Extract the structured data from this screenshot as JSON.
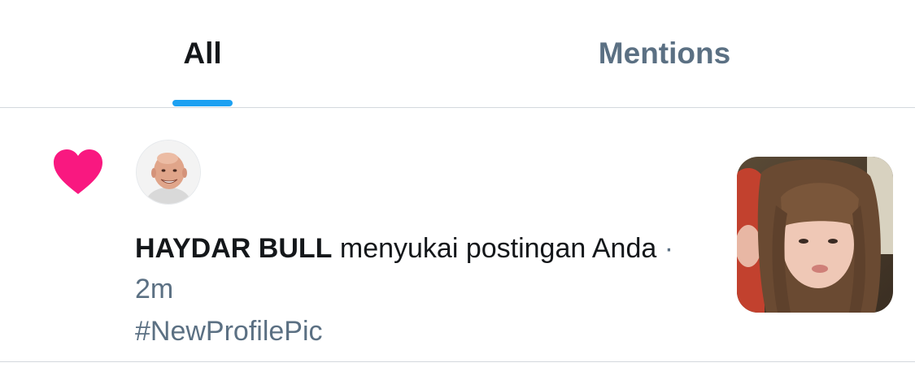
{
  "tabs": {
    "all_label": "All",
    "mentions_label": "Mentions",
    "active": "All"
  },
  "notification": {
    "icon": "heart-icon",
    "icon_color": "#f91880",
    "user_name": "HAYDAR BULL",
    "action_text": " menyukai postingan Anda",
    "separator": " · ",
    "time": "2m",
    "hashtag": "#NewProfilePic",
    "avatar_icon": "avatar",
    "thumbnail_icon": "post-thumbnail"
  },
  "colors": {
    "accent": "#1da1f2",
    "text_primary": "#14171a",
    "text_secondary": "#5b7083",
    "divider": "#d3d8dd"
  }
}
